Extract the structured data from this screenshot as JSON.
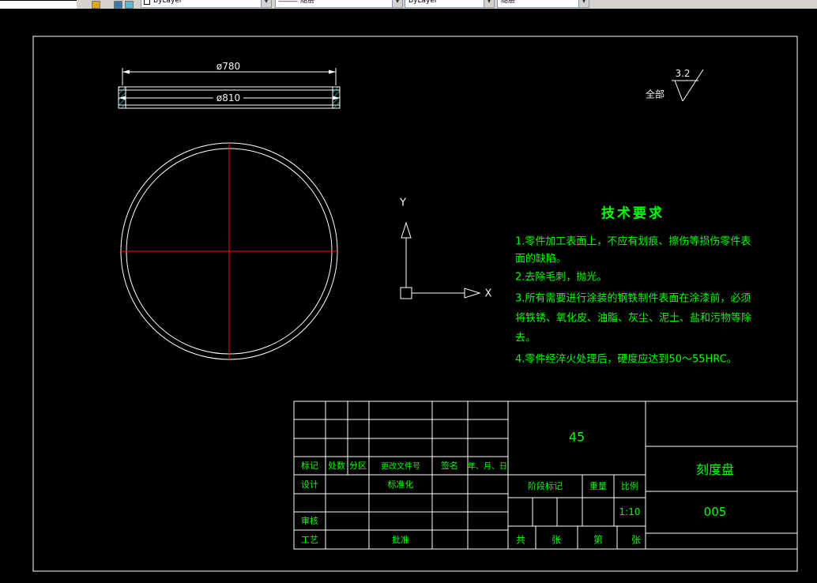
{
  "colors": {
    "line": "#ffffff",
    "centerline": "#ff0000",
    "text_green": "#00ff00",
    "hatch": "#00b4b4",
    "toolbar_bg": "#d6d3ce"
  },
  "toolbar": {
    "color_control": "ByLayer",
    "linetype_control": "随层",
    "lineweight_control": "ByLayer",
    "plotstyle_control": "随层"
  },
  "views": {
    "dim_top": "ø780",
    "dim_overall": "ø810"
  },
  "ucs": {
    "x": "X",
    "y": "Y"
  },
  "surface": {
    "scope": "全部",
    "roughness": "3.2"
  },
  "tech": {
    "title": "技术要求",
    "lines": [
      "1.零件加工表面上，不应有划痕、擦伤等损伤零件表",
      "面的缺陷。",
      "2.去除毛刺，抛光。",
      "3.所有需要进行涂装的钢铁制件表面在涂漆前，必须",
      "将铁锈、氧化皮、油脂、灰尘、泥土、盐和污物等除",
      "去。",
      "4.零件经淬火处理后，硬度应达到50～55HRC。"
    ]
  },
  "titleblock": {
    "material": "45",
    "part_name": "刻度盘",
    "drawing_no": "005",
    "scale_value": "1:10",
    "labels": {
      "mark": "标记",
      "qty": "处数",
      "zone": "分区",
      "file_no": "更改文件号",
      "sign": "签名",
      "date": "年、月、日",
      "design": "设计",
      "standardize": "标准化",
      "check": "审核",
      "process": "工艺",
      "approve": "批准",
      "stage": "阶段标记",
      "weight": "重量",
      "scale": "比例",
      "total": "共",
      "sheet1": "张",
      "no": "第",
      "sheet2": "张"
    }
  }
}
